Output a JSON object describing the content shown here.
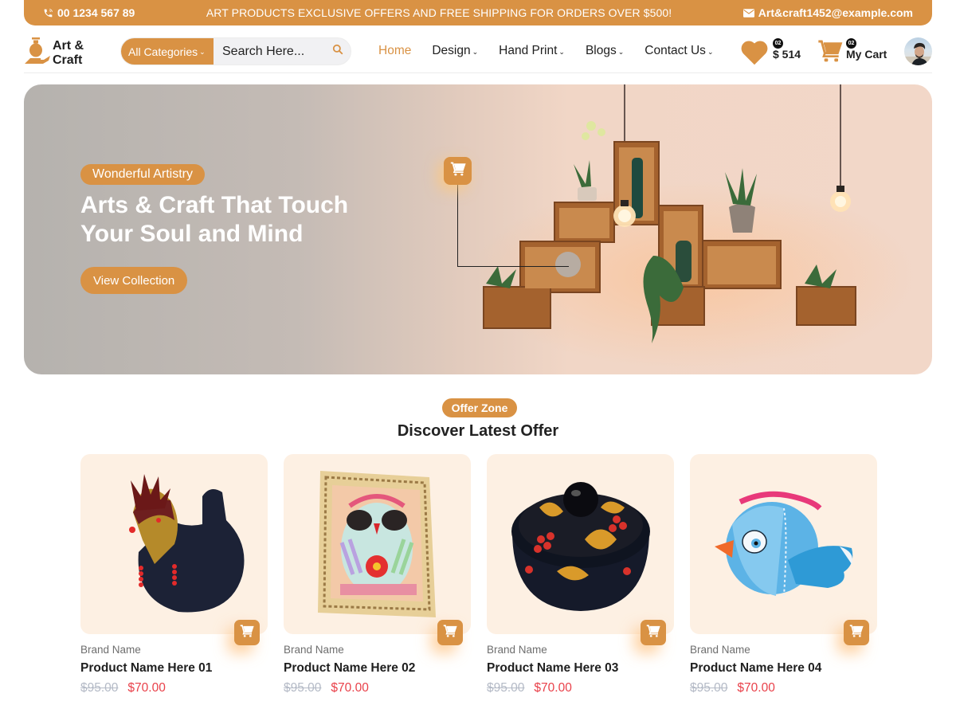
{
  "topbar": {
    "phone_icon": "phone-icon",
    "phone": "00 1234 567 89",
    "promo": "ART PRODUCTS EXCLUSIVE OFFERS AND FREE SHIPPING FOR ORDERS OVER $500!",
    "email_icon": "mail-icon",
    "email": "Art&craft1452@example.com"
  },
  "header": {
    "logo": {
      "icon": "vase-in-hand-icon",
      "line1": "Art &",
      "line2": "Craft"
    },
    "search": {
      "category_label": "All Categories",
      "placeholder": "Search Here...",
      "value": "",
      "icon": "search-icon"
    },
    "nav": [
      {
        "label": "Home",
        "active": true,
        "dropdown": false
      },
      {
        "label": "Design",
        "active": false,
        "dropdown": true
      },
      {
        "label": "Hand Print",
        "active": false,
        "dropdown": true
      },
      {
        "label": "Blogs",
        "active": false,
        "dropdown": true
      },
      {
        "label": "Contact Us",
        "active": false,
        "dropdown": true
      }
    ],
    "wishlist": {
      "icon": "heart-icon",
      "count": "02",
      "amount": "$ 514"
    },
    "cart": {
      "icon": "cart-icon",
      "count": "02",
      "label": "My Cart"
    },
    "avatar": "user-avatar"
  },
  "hero": {
    "tag": "Wonderful Artistry",
    "title_line1": "Arts & Craft That Touch",
    "title_line2": "Your Soul and Mind",
    "button": "View Collection",
    "hotspot_icon": "cart-icon"
  },
  "offers": {
    "tag": "Offer Zone",
    "title": "Discover Latest Offer",
    "products": [
      {
        "brand": "Brand Name",
        "name": "Product Name Here 01",
        "old_price": "$95.00",
        "price": "$70.00",
        "image": "rooster-figurine"
      },
      {
        "brand": "Brand Name",
        "name": "Product Name Here 02",
        "old_price": "$95.00",
        "price": "$70.00",
        "image": "owl-painting-frame"
      },
      {
        "brand": "Brand Name",
        "name": "Product Name Here 03",
        "old_price": "$95.00",
        "price": "$70.00",
        "image": "painted-lidded-bowl"
      },
      {
        "brand": "Brand Name",
        "name": "Product Name Here 04",
        "old_price": "$95.00",
        "price": "$70.00",
        "image": "blue-bird-figurine"
      }
    ]
  },
  "colors": {
    "accent": "#d99244",
    "sale_price": "#e9414a",
    "old_price": "#b4bac6",
    "card_bg": "#fdf0e3",
    "text": "#1f1f1f"
  }
}
